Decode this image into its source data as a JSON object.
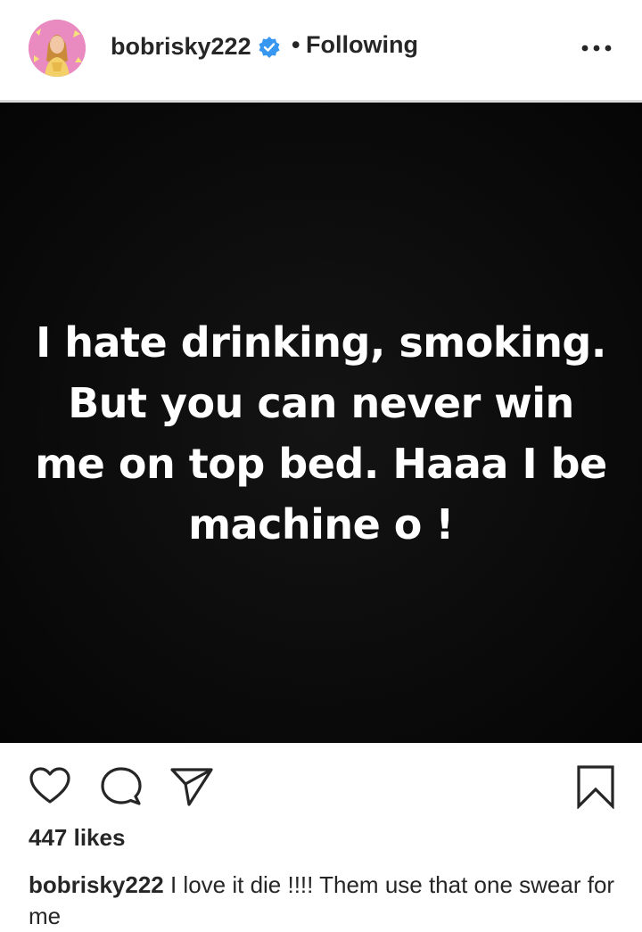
{
  "header": {
    "username": "bobrisky222",
    "separator": "•",
    "follow_status": "Following",
    "icons": {
      "avatar": "profile-avatar",
      "verified": "verified-badge-icon",
      "more": "more-options-icon"
    },
    "colors": {
      "verified": "#3897f0"
    }
  },
  "post": {
    "text_lines": [
      "I hate drinking, smoking.",
      "But you can never win",
      "me on top bed. Haaa I be",
      "machine o !"
    ],
    "background": "#0b0b0b",
    "text_color": "#ffffff"
  },
  "actions": {
    "icons": [
      "heart-icon",
      "comment-icon",
      "share-icon",
      "bookmark-icon"
    ]
  },
  "likes": "447 likes",
  "caption": {
    "username": "bobrisky222",
    "text": " I love it die !!!! Them use that one swear for me"
  }
}
